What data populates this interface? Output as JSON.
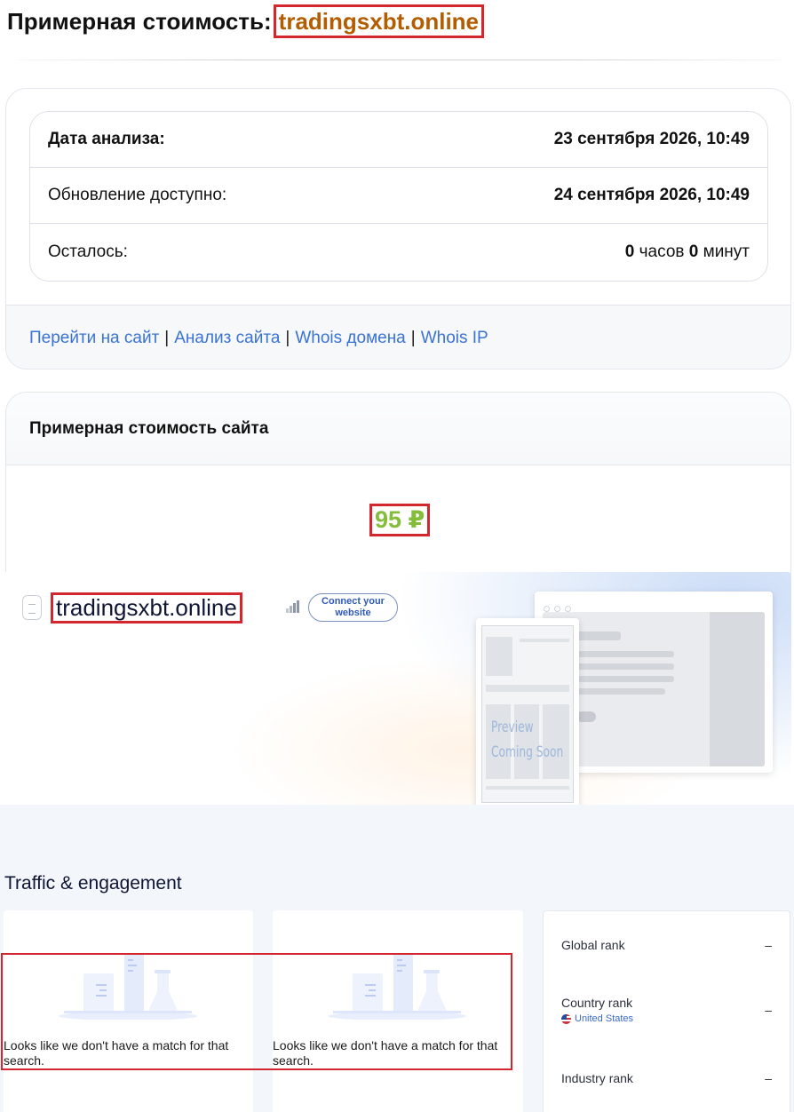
{
  "header": {
    "title_prefix": "Примерная стоимость:",
    "domain": "tradingsxbt.online"
  },
  "analysis": {
    "rows": [
      {
        "label": "Дата анализа:",
        "value": "23 сентября 2026, 10:49"
      },
      {
        "label": "Обновление доступно:",
        "value": "24 сентября 2026, 10:49"
      }
    ],
    "remaining": {
      "label": "Осталось:",
      "hours": "0",
      "hours_unit": "часов",
      "minutes": "0",
      "minutes_unit": "минут"
    },
    "links": [
      {
        "label": "Перейти на сайт"
      },
      {
        "label": "Анализ сайта"
      },
      {
        "label": "Whois домена"
      },
      {
        "label": "Whois IP"
      }
    ],
    "separator": "|"
  },
  "valuation": {
    "title": "Примерная стоимость сайта",
    "amount": "95 ₽"
  },
  "preview": {
    "domain": "tradingsxbt.online",
    "connect_label": "Connect your website",
    "placeholder_line1": "Preview",
    "placeholder_line2": "Coming Soon"
  },
  "traffic": {
    "title": "Traffic & engagement",
    "empty_message": "Looks like we don't have a match for that search.",
    "ranks": [
      {
        "label": "Global rank",
        "value": "–"
      },
      {
        "label": "Country rank",
        "sub": "United States",
        "value": "–"
      },
      {
        "label": "Industry rank",
        "value": "–"
      }
    ]
  },
  "colors": {
    "highlight": "#d3262e",
    "heading_domain": "#b35c00",
    "price": "#84bd3a",
    "link": "#3a73d4"
  }
}
